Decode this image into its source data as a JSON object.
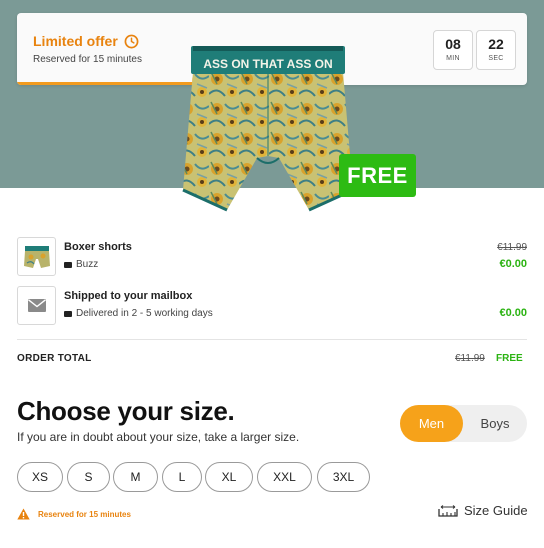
{
  "offer": {
    "title": "Limited offer",
    "subtitle": "Reserved for 15 minutes",
    "timer": [
      {
        "value": "08",
        "unit": "MIN"
      },
      {
        "value": "22",
        "unit": "SEC"
      }
    ],
    "accent_color": "#f29b1e"
  },
  "product": {
    "badge": "FREE",
    "waistband_text": "ASS ON THAT ASS ON",
    "badge_color": "#2dbb13"
  },
  "line_items": [
    {
      "name": "Boxer shorts",
      "variant": "Buzz",
      "old_price": "€11.99",
      "price": "€0.00",
      "icon": "boxer-thumbnail"
    },
    {
      "name": "Shipped to your mailbox",
      "variant": "Delivered in 2 - 5 working days",
      "old_price": "",
      "price": "€0.00",
      "icon": "envelope-icon"
    }
  ],
  "order_total": {
    "label": "ORDER TOTAL",
    "old_price": "€11.99",
    "price": "FREE"
  },
  "size_picker": {
    "title": "Choose your size.",
    "hint": "If you are in doubt about your size, take a larger size.",
    "gender_options": [
      "Men",
      "Boys"
    ],
    "selected_gender": "Men",
    "sizes": [
      "XS",
      "S",
      "M",
      "L",
      "XL",
      "XXL",
      "3XL"
    ]
  },
  "footer": {
    "reserved_text": "Reserved for 15 minutes",
    "size_guide_label": "Size Guide"
  },
  "colors": {
    "hero_bg": "#7b9a96",
    "price_green": "#2bb312",
    "toggle_active": "#f6a21a"
  }
}
